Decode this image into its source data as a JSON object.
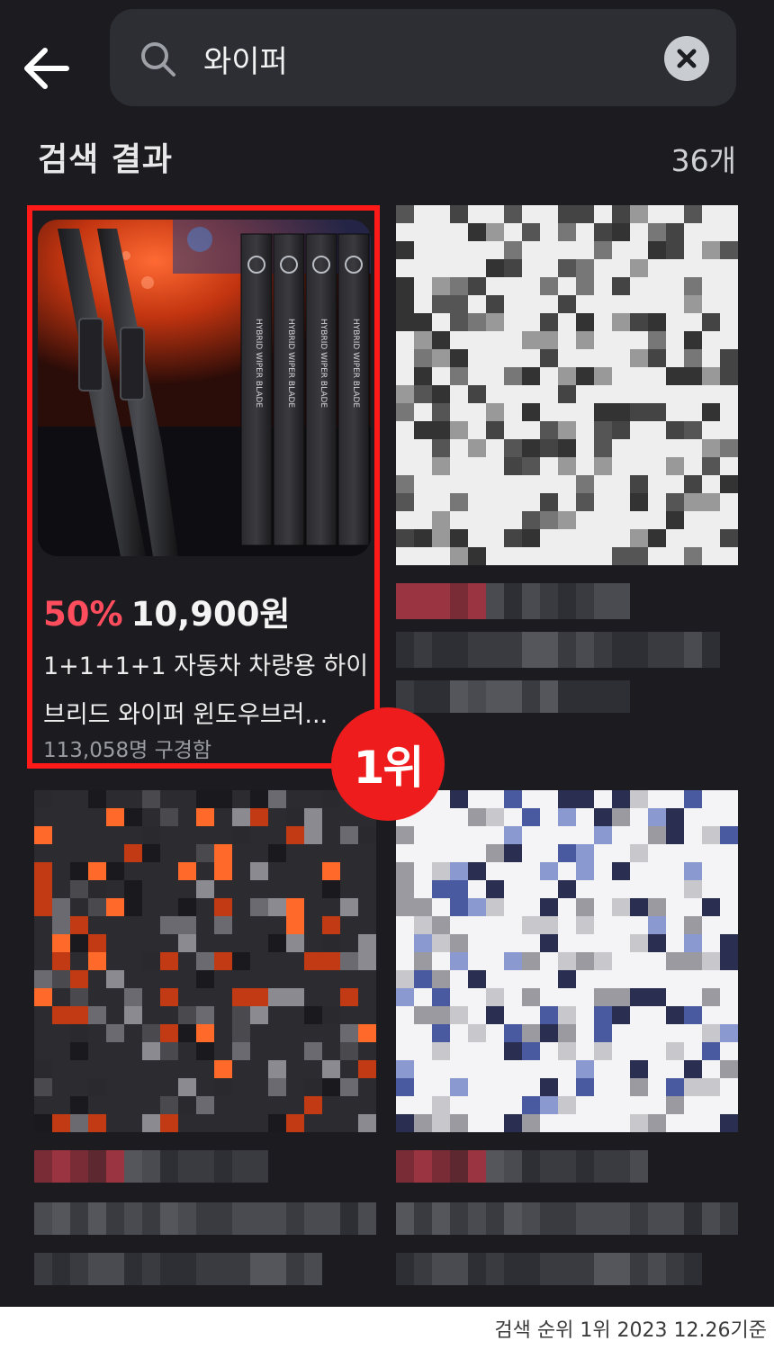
{
  "header": {
    "back_icon": "arrow-left-icon",
    "search_icon": "search-icon",
    "search_value": "와이퍼",
    "clear_icon": "close-circle-icon"
  },
  "results": {
    "title": "검색 결과",
    "count": "36개"
  },
  "featured_product": {
    "discount": "50%",
    "price": "10,900원",
    "title_line1": "1+1+1+1 자동차 차량용 하이",
    "title_line2": "브리드 와이퍼 윈도우브러...",
    "buyers": "113,058명 구경함",
    "package_text": "HYBRID WIPER BLADE",
    "rank_badge": "1위"
  },
  "colors": {
    "background": "#1c1c20",
    "search_bar": "#2c2e33",
    "discount": "#ff4d5e",
    "highlight_border": "#ff1a1a",
    "rank_badge": "#ee1c1c"
  },
  "footer": {
    "note": "검색 순위 1위 2023 12.26기준"
  }
}
